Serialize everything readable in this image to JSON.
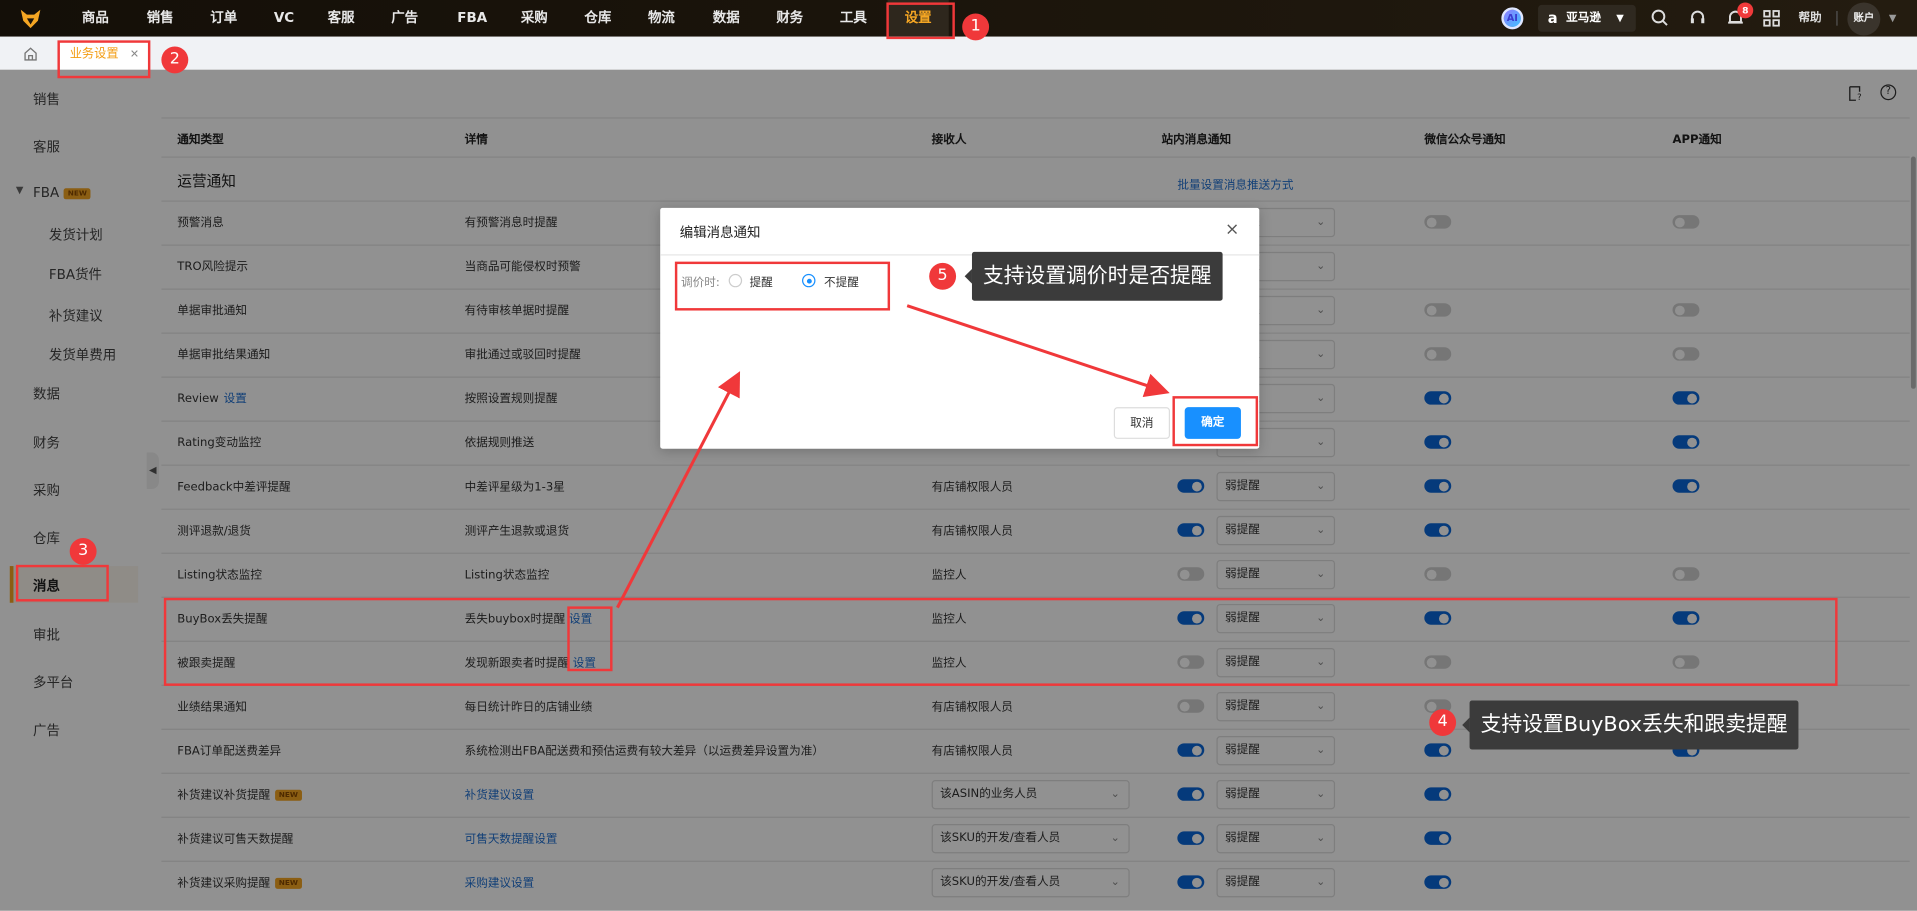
{
  "topnav": {
    "items": [
      "商品",
      "销售",
      "订单",
      "VC",
      "客服",
      "广告",
      "FBA",
      "采购",
      "仓库",
      "物流",
      "数据",
      "财务",
      "工具",
      "设置"
    ],
    "active": "设置",
    "ai_label": "AI",
    "platform": "亚马逊",
    "notification_count": "8",
    "help": "帮助",
    "account": "账户"
  },
  "tabbar": {
    "tab_label": "业务设置",
    "close": "✕"
  },
  "sidebar": {
    "items": [
      {
        "label": "销售",
        "sub": false
      },
      {
        "label": "客服",
        "sub": false
      },
      {
        "label": "FBA",
        "sub": false,
        "tag": "NEW"
      },
      {
        "label": "发货计划",
        "sub": true
      },
      {
        "label": "FBA货件",
        "sub": true
      },
      {
        "label": "补货建议",
        "sub": true
      },
      {
        "label": "发货单费用",
        "sub": true
      },
      {
        "label": "数据",
        "sub": false
      },
      {
        "label": "财务",
        "sub": false
      },
      {
        "label": "采购",
        "sub": false
      },
      {
        "label": "仓库",
        "sub": false
      },
      {
        "label": "消息",
        "sub": false,
        "active": true
      },
      {
        "label": "审批",
        "sub": false
      },
      {
        "label": "多平台",
        "sub": false
      },
      {
        "label": "广告",
        "sub": false
      }
    ]
  },
  "table": {
    "headers": [
      "通知类型",
      "详情",
      "接收人",
      "站内消息通知",
      "微信公众号通知",
      "APP通知"
    ],
    "section": "运营通知",
    "batch_link": "批量设置消息推送方式",
    "level_default": "弱提醒",
    "rows": [
      {
        "type": "预警消息",
        "detail": "有预警消息时提醒",
        "receiver": "",
        "station": null,
        "wechat": false,
        "app": false
      },
      {
        "type": "TRO风险提示",
        "detail": "当商品可能侵权时预警",
        "receiver": "",
        "station": null,
        "wechat": null,
        "app": null
      },
      {
        "type": "单据审批通知",
        "detail": "有待审核单据时提醒",
        "receiver": "",
        "station": null,
        "wechat": false,
        "app": false
      },
      {
        "type": "单据审批结果通知",
        "detail": "审批通过或驳回时提醒",
        "receiver": "",
        "station": null,
        "wechat": false,
        "app": false
      },
      {
        "type": "Review",
        "type_link": "设置",
        "detail": "按照设置规则提醒",
        "receiver": "",
        "station": null,
        "wechat": true,
        "app": true
      },
      {
        "type": "Rating变动监控",
        "detail": "依据规则推送",
        "receiver": "",
        "station": null,
        "wechat": true,
        "app": true
      },
      {
        "type": "Feedback中差评提醒",
        "detail": "中差评星级为1-3星",
        "receiver": "有店铺权限人员",
        "station": true,
        "wechat": true,
        "app": true
      },
      {
        "type": "测评退款/退货",
        "detail": "测评产生退款或退货",
        "receiver": "有店铺权限人员",
        "station": true,
        "wechat": true,
        "app": null
      },
      {
        "type": "Listing状态监控",
        "detail": "Listing状态监控",
        "receiver": "监控人",
        "station": false,
        "wechat": false,
        "app": false
      },
      {
        "type": "BuyBox丢失提醒",
        "detail": "丢失buybox时提醒",
        "detail_link": "设置",
        "receiver": "监控人",
        "station": true,
        "wechat": true,
        "app": true
      },
      {
        "type": "被跟卖提醒",
        "detail": "发现新跟卖者时提醒",
        "detail_link": "设置",
        "receiver": "监控人",
        "station": false,
        "wechat": false,
        "app": false
      },
      {
        "type": "业绩结果通知",
        "detail": "每日统计昨日的店铺业绩",
        "receiver": "有店铺权限人员",
        "station": false,
        "wechat": false,
        "app": null
      },
      {
        "type": "FBA订单配送费差异",
        "detail": "系统检测出FBA配送费和预估运费有较大差异（以运费差异设置为准）",
        "receiver": "有店铺权限人员",
        "station": true,
        "wechat": true,
        "app": true
      },
      {
        "type": "补货建议补货提醒",
        "tag": "NEW",
        "detail_link_only": "补货建议设置",
        "receiver_select": "该ASIN的业务人员",
        "station": true,
        "wechat": true,
        "app": null
      },
      {
        "type": "补货建议可售天数提醒",
        "detail_link_only": "可售天数提醒设置",
        "receiver_select": "该SKU的开发/查看人员",
        "station": true,
        "wechat": true,
        "app": null
      },
      {
        "type": "补货建议采购提醒",
        "tag": "NEW",
        "detail_link_only": "采购建议设置",
        "receiver_select": "该SKU的开发/查看人员",
        "station": true,
        "wechat": true,
        "app": null
      }
    ]
  },
  "modal": {
    "title": "编辑消息通知",
    "field_label": "调价时:",
    "options": [
      "提醒",
      "不提醒"
    ],
    "selected": "不提醒",
    "cancel": "取消",
    "confirm": "确定"
  },
  "annotations": {
    "badges": [
      "1",
      "2",
      "3",
      "4",
      "5"
    ],
    "tip4": "支持设置BuyBox丢失和跟卖提醒",
    "tip5": "支持设置调价时是否提醒"
  },
  "colors": {
    "accent": "#f5a623",
    "primary": "#1890ff",
    "toggle_on": "#0a66d8",
    "annotation": "#f0383a"
  }
}
